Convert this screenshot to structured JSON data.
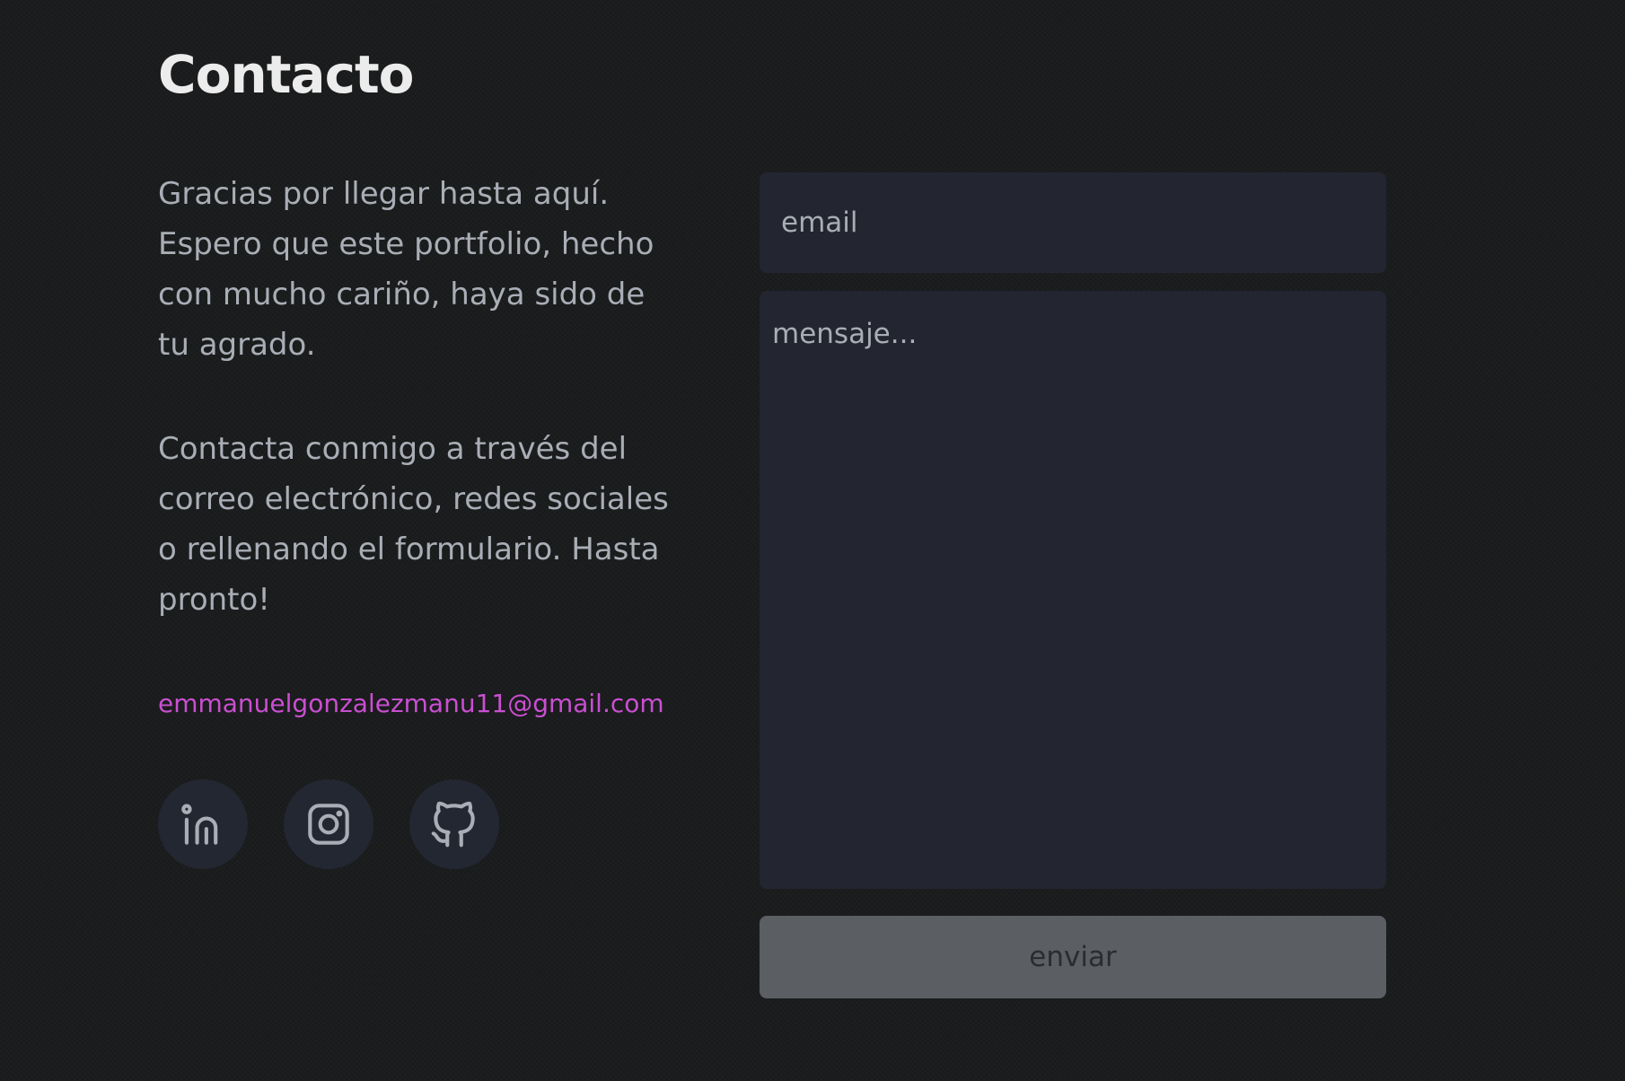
{
  "page": {
    "title": "Contacto"
  },
  "intro": {
    "paragraph_1": "Gracias por llegar hasta aquí. Espero que este portfolio, hecho con mucho cariño, haya sido de tu agrado.",
    "paragraph_2": "Contacta conmigo a través del correo electrónico, redes sociales o rellenando el formulario. Hasta pronto!"
  },
  "contact": {
    "email": "emmanuelgonzalezmanu11@gmail.com"
  },
  "social": [
    {
      "icon": "linkedin-icon"
    },
    {
      "icon": "instagram-icon"
    },
    {
      "icon": "github-icon"
    }
  ],
  "form": {
    "email_value": "",
    "email_placeholder": "email",
    "message_value": "",
    "message_placeholder": "mensaje...",
    "submit_label": "enviar"
  },
  "colors": {
    "background": "#1b1c1d",
    "accent": "#c94fd2",
    "field_background": "#232630",
    "button_background": "#5b5e63",
    "text_muted": "#a9aeb6"
  }
}
